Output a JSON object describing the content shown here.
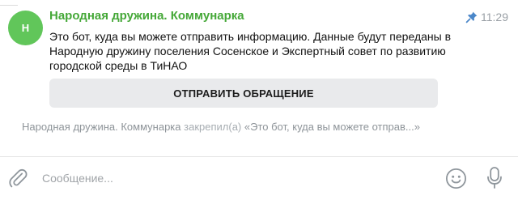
{
  "message": {
    "avatar_letter": "Н",
    "sender": "Народная дружина. Коммунарка",
    "time": "11:29",
    "text": "Это бот, куда вы можете отправить информацию. Данные будут переданы в Народную дружину поселения Сосенское и Экспертный совет по развитию городской среды в ТиНАО",
    "button_label": "ОТПРАВИТЬ ОБРАЩЕНИЕ"
  },
  "pin_notice": {
    "actor": "Народная дружина. Коммунарка",
    "action": "закрепил(а)",
    "excerpt": "«Это бот, куда вы можете отправ...»"
  },
  "composer": {
    "placeholder": "Сообщение..."
  },
  "icons": {
    "pin": "pin-icon",
    "attach": "paperclip-icon",
    "emoji": "emoji-icon",
    "mic": "microphone-icon"
  },
  "colors": {
    "sender_name": "#45a838",
    "avatar_bg": "#61c65a",
    "pin_accent": "#4b87c9",
    "meta_text": "#9aa0a6",
    "button_bg": "#e9eaec"
  }
}
